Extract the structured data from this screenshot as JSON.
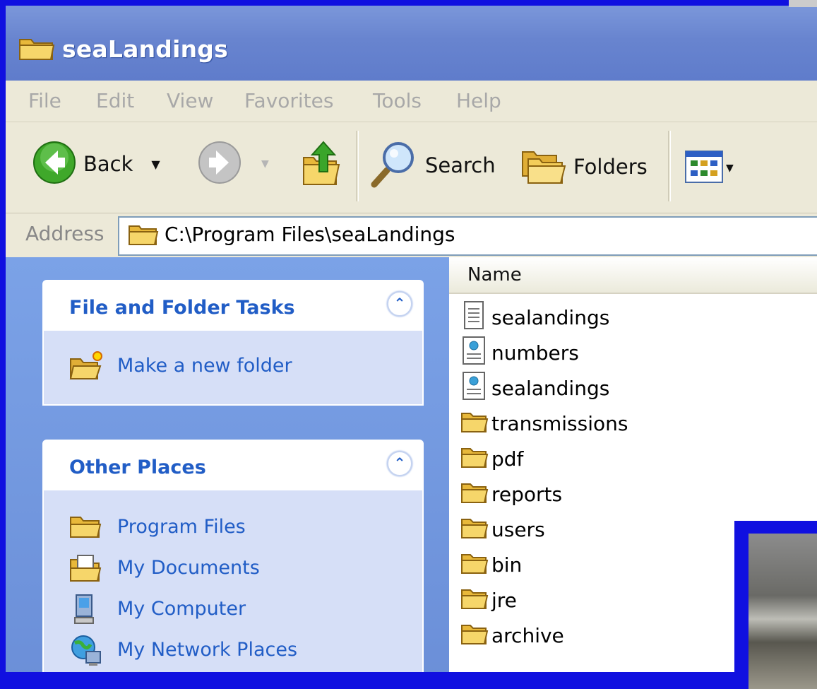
{
  "window": {
    "title": "seaLandings"
  },
  "menu": [
    "File",
    "Edit",
    "View",
    "Favorites",
    "Tools",
    "Help"
  ],
  "toolbar": {
    "back_label": "Back",
    "search_label": "Search",
    "folders_label": "Folders"
  },
  "address": {
    "label": "Address",
    "value": "C:\\Program Files\\seaLandings"
  },
  "tasks_panel": {
    "title": "File and Folder Tasks",
    "items": [
      {
        "label": "Make a new folder",
        "icon": "new-folder-icon"
      }
    ]
  },
  "places_panel": {
    "title": "Other Places",
    "items": [
      {
        "label": "Program Files",
        "icon": "folder-icon"
      },
      {
        "label": "My Documents",
        "icon": "my-documents-icon"
      },
      {
        "label": "My Computer",
        "icon": "my-computer-icon"
      },
      {
        "label": "My Network Places",
        "icon": "network-places-icon"
      }
    ]
  },
  "file_list": {
    "column_name": "Name",
    "files": [
      {
        "name": "sealandings",
        "type": "text"
      },
      {
        "name": "numbers",
        "type": "html"
      },
      {
        "name": "sealandings",
        "type": "html"
      },
      {
        "name": "transmissions",
        "type": "folder"
      },
      {
        "name": "pdf",
        "type": "folder"
      },
      {
        "name": "reports",
        "type": "folder"
      },
      {
        "name": "users",
        "type": "folder"
      },
      {
        "name": "bin",
        "type": "folder"
      },
      {
        "name": "jre",
        "type": "folder"
      },
      {
        "name": "archive",
        "type": "folder"
      }
    ]
  },
  "colors": {
    "desktop_border": "#1010e0",
    "titlebar": "#6884cf",
    "link": "#215dc6",
    "pane": "#6b8fd8"
  }
}
